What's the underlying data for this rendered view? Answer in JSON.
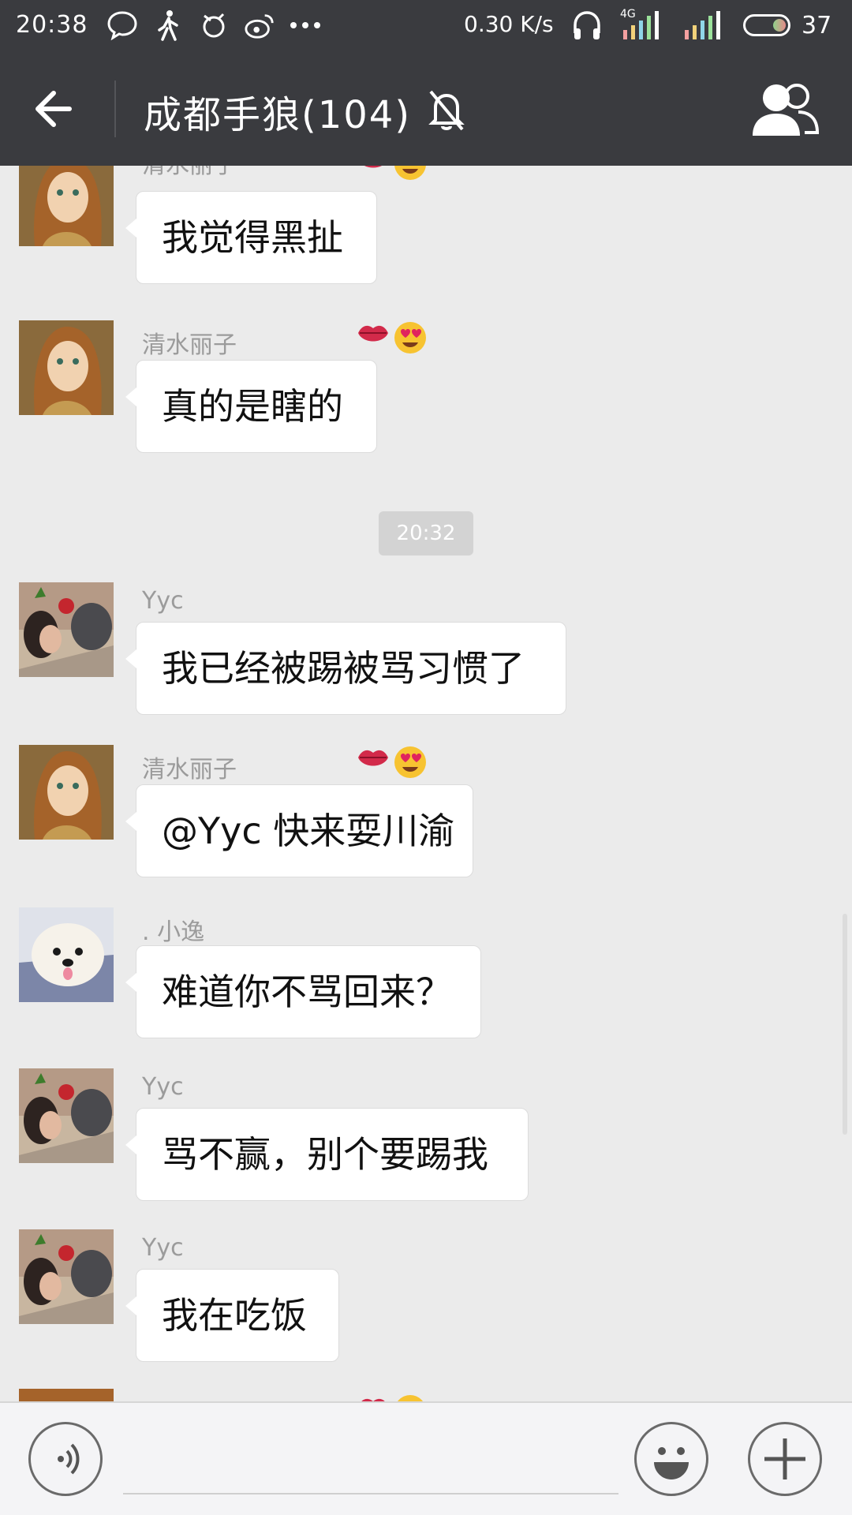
{
  "status_bar": {
    "time": "20:38",
    "net_speed": "0.30 K/s",
    "network_type": "4G",
    "battery": "37",
    "icons": [
      "chat-bubble-icon",
      "walking-icon",
      "app-icon",
      "weibo-icon",
      "more-dots-icon",
      "headphones-icon",
      "signal-icon",
      "signal-icon",
      "battery-icon"
    ]
  },
  "header": {
    "title": "成都手狼(104)",
    "back_icon": "back-arrow-icon",
    "mute_icon": "bell-off-icon",
    "group_icon": "group-members-icon"
  },
  "messages": [
    {
      "sender": "清水丽子",
      "text": "我觉得黑扯",
      "avatar": "anime-woman",
      "emoji": [
        "kiss-lips",
        "heart-eyes"
      ]
    },
    {
      "sender": "清水丽子",
      "text": "真的是瞎的",
      "avatar": "anime-woman",
      "emoji": [
        "kiss-lips",
        "heart-eyes"
      ]
    },
    {
      "time": "20:32"
    },
    {
      "sender": "Yyc",
      "text": "我已经被踢被骂习惯了",
      "avatar": "person-with-dog"
    },
    {
      "sender": "清水丽子",
      "text": "@Yyc 快来耍川渝",
      "avatar": "anime-woman",
      "emoji": [
        "kiss-lips",
        "heart-eyes"
      ]
    },
    {
      "sender": ".        小逸",
      "text": "难道你不骂回来？",
      "avatar": "white-puppy"
    },
    {
      "sender": "Yyc",
      "text": "骂不赢，别个要踢我",
      "avatar": "person-with-dog"
    },
    {
      "sender": "Yyc",
      "text": "我在吃饭",
      "avatar": "person-with-dog"
    }
  ],
  "input": {
    "value": "",
    "placeholder": "",
    "voice_icon": "voice-icon",
    "emoji_icon": "smiley-icon",
    "plus_icon": "plus-icon"
  },
  "colors": {
    "header_bg": "#3a3b3f",
    "chat_bg": "#ebebeb",
    "bubble_bg": "#ffffff",
    "time_chip_bg": "#d3d3d3"
  }
}
